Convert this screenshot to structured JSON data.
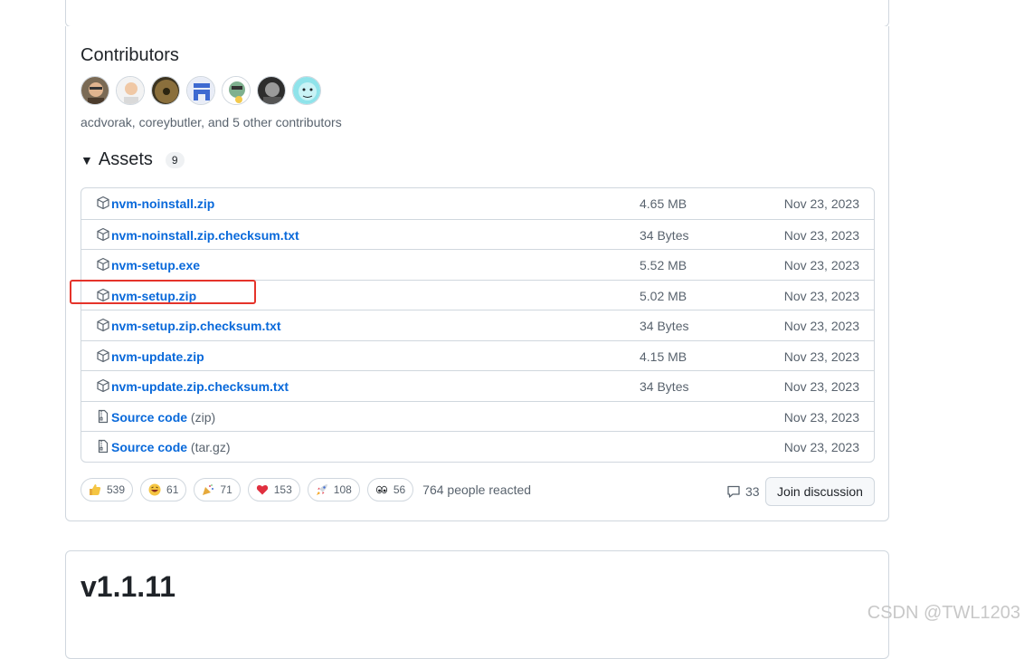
{
  "contributors": {
    "title": "Contributors",
    "avatars": [
      "avatar-1",
      "avatar-2",
      "avatar-3",
      "avatar-4",
      "avatar-5",
      "avatar-6",
      "avatar-7"
    ],
    "summary": "acdvorak, coreybutler, and 5 other contributors"
  },
  "assets": {
    "title": "Assets",
    "count": "9",
    "items": [
      {
        "name": "nvm-noinstall.zip",
        "suffix": "",
        "size": "4.65 MB",
        "date": "Nov 23, 2023",
        "icon": "package-icon"
      },
      {
        "name": "nvm-noinstall.zip.checksum.txt",
        "suffix": "",
        "size": "34 Bytes",
        "date": "Nov 23, 2023",
        "icon": "package-icon"
      },
      {
        "name": "nvm-setup.exe",
        "suffix": "",
        "size": "5.52 MB",
        "date": "Nov 23, 2023",
        "icon": "package-icon"
      },
      {
        "name": "nvm-setup.zip",
        "suffix": "",
        "size": "5.02 MB",
        "date": "Nov 23, 2023",
        "icon": "package-icon"
      },
      {
        "name": "nvm-setup.zip.checksum.txt",
        "suffix": "",
        "size": "34 Bytes",
        "date": "Nov 23, 2023",
        "icon": "package-icon"
      },
      {
        "name": "nvm-update.zip",
        "suffix": "",
        "size": "4.15 MB",
        "date": "Nov 23, 2023",
        "icon": "package-icon"
      },
      {
        "name": "nvm-update.zip.checksum.txt",
        "suffix": "",
        "size": "34 Bytes",
        "date": "Nov 23, 2023",
        "icon": "package-icon"
      },
      {
        "name": "Source code",
        "suffix": " (zip)",
        "size": "",
        "date": "Nov 23, 2023",
        "icon": "file-zip-icon"
      },
      {
        "name": "Source code",
        "suffix": " (tar.gz)",
        "size": "",
        "date": "Nov 23, 2023",
        "icon": "file-zip-icon"
      }
    ]
  },
  "reactions": {
    "items": [
      {
        "emoji": "thumbs-up",
        "count": "539"
      },
      {
        "emoji": "laugh",
        "count": "61"
      },
      {
        "emoji": "hooray",
        "count": "71"
      },
      {
        "emoji": "heart",
        "count": "153"
      },
      {
        "emoji": "rocket",
        "count": "108"
      },
      {
        "emoji": "eyes",
        "count": "56"
      }
    ],
    "total": "764 people reacted"
  },
  "discussion": {
    "comment_count": "33",
    "join_label": "Join discussion"
  },
  "next_release": {
    "title": "v1.1.11"
  },
  "watermark": "CSDN @TWL1203",
  "colors": {
    "link": "#0969da",
    "highlight": "#e5332a",
    "border": "#d0d7de"
  }
}
